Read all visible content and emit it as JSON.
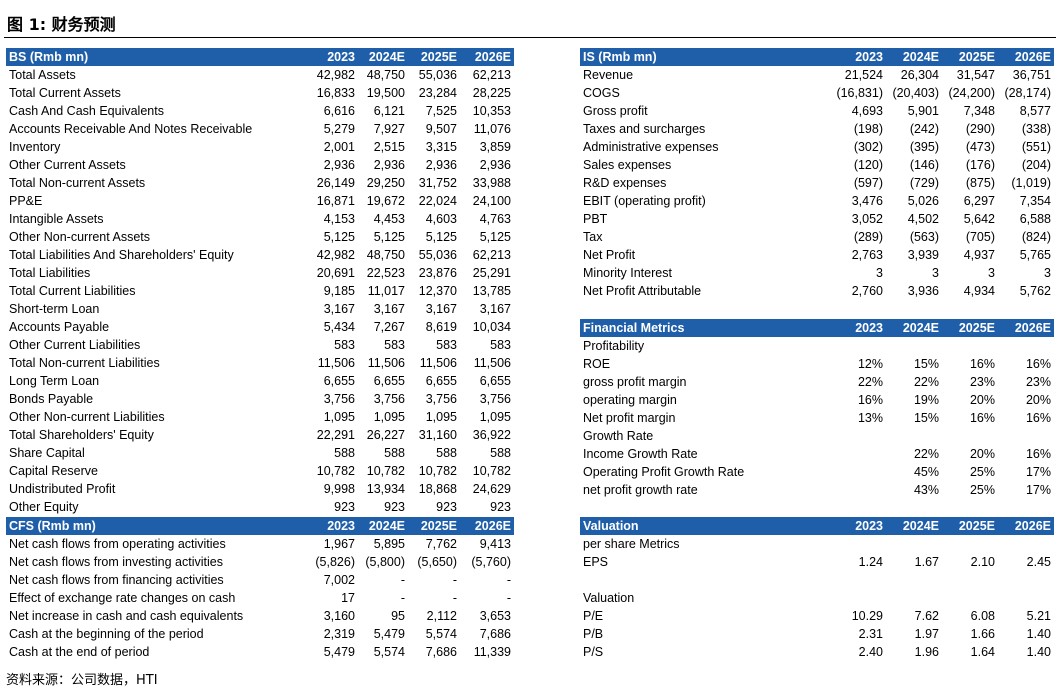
{
  "figure_title": "图 1: 财务预测",
  "source_note": "资料来源：公司数据，HTI",
  "header_color": "#1f5ea8",
  "bs": {
    "header": [
      "BS (Rmb mn)",
      "2023",
      "2024E",
      "2025E",
      "2026E"
    ],
    "rows": [
      [
        "Total Assets",
        "42,982",
        "48,750",
        "55,036",
        "62,213"
      ],
      [
        "Total Current Assets",
        "16,833",
        "19,500",
        "23,284",
        "28,225"
      ],
      [
        "Cash And Cash Equivalents",
        "6,616",
        "6,121",
        "7,525",
        "10,353"
      ],
      [
        "Accounts Receivable And Notes Receivable",
        "5,279",
        "7,927",
        "9,507",
        "11,076"
      ],
      [
        "Inventory",
        "2,001",
        "2,515",
        "3,315",
        "3,859"
      ],
      [
        "Other Current Assets",
        "2,936",
        "2,936",
        "2,936",
        "2,936"
      ],
      [
        "Total Non-current Assets",
        "26,149",
        "29,250",
        "31,752",
        "33,988"
      ],
      [
        "PP&E",
        "16,871",
        "19,672",
        "22,024",
        "24,100"
      ],
      [
        "Intangible Assets",
        "4,153",
        "4,453",
        "4,603",
        "4,763"
      ],
      [
        "Other Non-current Assets",
        "5,125",
        "5,125",
        "5,125",
        "5,125"
      ],
      [
        "Total Liabilities And Shareholders' Equity",
        "42,982",
        "48,750",
        "55,036",
        "62,213"
      ],
      [
        "Total Liabilities",
        "20,691",
        "22,523",
        "23,876",
        "25,291"
      ],
      [
        "Total Current Liabilities",
        "9,185",
        "11,017",
        "12,370",
        "13,785"
      ],
      [
        "Short-term Loan",
        "3,167",
        "3,167",
        "3,167",
        "3,167"
      ],
      [
        "Accounts Payable",
        "5,434",
        "7,267",
        "8,619",
        "10,034"
      ],
      [
        "Other Current Liabilities",
        "583",
        "583",
        "583",
        "583"
      ],
      [
        "Total Non-current Liabilities",
        "11,506",
        "11,506",
        "11,506",
        "11,506"
      ],
      [
        "Long Term Loan",
        "6,655",
        "6,655",
        "6,655",
        "6,655"
      ],
      [
        "Bonds Payable",
        "3,756",
        "3,756",
        "3,756",
        "3,756"
      ],
      [
        "Other Non-current Liabilities",
        "1,095",
        "1,095",
        "1,095",
        "1,095"
      ],
      [
        "Total Shareholders' Equity",
        "22,291",
        "26,227",
        "31,160",
        "36,922"
      ],
      [
        "Share Capital",
        "588",
        "588",
        "588",
        "588"
      ],
      [
        "Capital Reserve",
        "10,782",
        "10,782",
        "10,782",
        "10,782"
      ],
      [
        "Undistributed Profit",
        "9,998",
        "13,934",
        "18,868",
        "24,629"
      ],
      [
        "Other Equity",
        "923",
        "923",
        "923",
        "923"
      ]
    ]
  },
  "cfs": {
    "header": [
      "CFS (Rmb mn)",
      "2023",
      "2024E",
      "2025E",
      "2026E"
    ],
    "rows": [
      [
        "Net cash flows from operating activities",
        "1,967",
        "5,895",
        "7,762",
        "9,413"
      ],
      [
        "Net cash flows from investing activities",
        "(5,826)",
        "(5,800)",
        "(5,650)",
        "(5,760)"
      ],
      [
        "Net cash flows from financing activities",
        "7,002",
        "-",
        "-",
        "-"
      ],
      [
        "Effect of exchange rate changes on cash",
        "17",
        "-",
        "-",
        "-"
      ],
      [
        "Net increase in cash and cash equivalents",
        "3,160",
        "95",
        "2,112",
        "3,653"
      ],
      [
        "Cash at the beginning of the period",
        "2,319",
        "5,479",
        "5,574",
        "7,686"
      ],
      [
        "Cash at the end of period",
        "5,479",
        "5,574",
        "7,686",
        "11,339"
      ]
    ]
  },
  "is": {
    "header": [
      "IS (Rmb mn)",
      "2023",
      "2024E",
      "2025E",
      "2026E"
    ],
    "rows": [
      [
        "Revenue",
        "21,524",
        "26,304",
        "31,547",
        "36,751"
      ],
      [
        "COGS",
        "(16,831)",
        "(20,403)",
        "(24,200)",
        "(28,174)"
      ],
      [
        "Gross profit",
        "4,693",
        "5,901",
        "7,348",
        "8,577"
      ],
      [
        "Taxes and surcharges",
        "(198)",
        "(242)",
        "(290)",
        "(338)"
      ],
      [
        "Administrative expenses",
        "(302)",
        "(395)",
        "(473)",
        "(551)"
      ],
      [
        "Sales expenses",
        "(120)",
        "(146)",
        "(176)",
        "(204)"
      ],
      [
        "R&D expenses",
        "(597)",
        "(729)",
        "(875)",
        "(1,019)"
      ],
      [
        "EBIT  (operating profit)",
        "3,476",
        "5,026",
        "6,297",
        "7,354"
      ],
      [
        "PBT",
        "3,052",
        "4,502",
        "5,642",
        "6,588"
      ],
      [
        "Tax",
        "(289)",
        "(563)",
        "(705)",
        "(824)"
      ],
      [
        "Net Profit",
        "2,763",
        "3,939",
        "4,937",
        "5,765"
      ],
      [
        "Minority Interest",
        "3",
        "3",
        "3",
        "3"
      ],
      [
        "Net Profit Attributable",
        "2,760",
        "3,936",
        "4,934",
        "5,762"
      ]
    ]
  },
  "fm": {
    "header": [
      "Financial Metrics",
      "2023",
      "2024E",
      "2025E",
      "2026E"
    ],
    "rows": [
      [
        "Profitability",
        "",
        "",
        "",
        ""
      ],
      [
        "ROE",
        "12%",
        "15%",
        "16%",
        "16%"
      ],
      [
        "gross profit margin",
        "22%",
        "22%",
        "23%",
        "23%"
      ],
      [
        "operating margin",
        "16%",
        "19%",
        "20%",
        "20%"
      ],
      [
        "Net profit margin",
        "13%",
        "15%",
        "16%",
        "16%"
      ],
      [
        "Growth Rate",
        "",
        "",
        "",
        ""
      ],
      [
        "Income Growth Rate",
        "",
        "22%",
        "20%",
        "16%"
      ],
      [
        "Operating Profit Growth Rate",
        "",
        "45%",
        "25%",
        "17%"
      ],
      [
        "net profit growth rate",
        "",
        "43%",
        "25%",
        "17%"
      ]
    ]
  },
  "val": {
    "header": [
      "Valuation",
      "2023",
      "2024E",
      "2025E",
      "2026E"
    ],
    "rows": [
      [
        "per share Metrics",
        "",
        "",
        "",
        ""
      ],
      [
        "EPS",
        "1.24",
        "1.67",
        "2.10",
        "2.45"
      ],
      [
        "",
        "",
        "",
        "",
        ""
      ],
      [
        "Valuation",
        "",
        "",
        "",
        ""
      ],
      [
        "P/E",
        "10.29",
        "7.62",
        "6.08",
        "5.21"
      ],
      [
        "P/B",
        "2.31",
        "1.97",
        "1.66",
        "1.40"
      ],
      [
        "P/S",
        "2.40",
        "1.96",
        "1.64",
        "1.40"
      ]
    ]
  }
}
